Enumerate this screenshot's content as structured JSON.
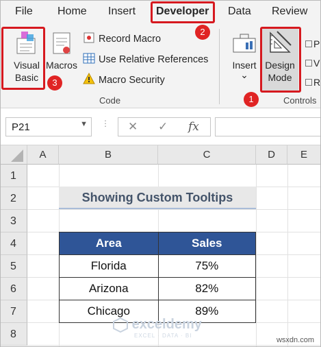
{
  "ribbon_tabs": [
    "File",
    "Home",
    "Insert",
    "Developer",
    "Data",
    "Review"
  ],
  "code_group": {
    "visual_basic": [
      "Visual",
      "Basic"
    ],
    "macros": "Macros",
    "record_macro": "Record Macro",
    "use_relative": "Use Relative References",
    "macro_security": "Macro Security",
    "label": "Code"
  },
  "controls_group": {
    "insert": "Insert",
    "insert_caret": "⌄",
    "design_mode": [
      "Design",
      "Mode"
    ],
    "label": "Controls",
    "cut_letters": [
      "P",
      "V",
      "R"
    ]
  },
  "callouts": [
    "1",
    "2",
    "3"
  ],
  "formula_bar": {
    "name_box": "P21",
    "cancel": "✕",
    "enter": "✓",
    "fx": "fx",
    "formula": ""
  },
  "columns": [
    "A",
    "B",
    "C",
    "D",
    "E"
  ],
  "rows": [
    "1",
    "2",
    "3",
    "4",
    "5",
    "6",
    "7",
    "8"
  ],
  "sheet": {
    "title": "Showing Custom Tooltips",
    "headers": [
      "Area",
      "Sales"
    ],
    "rows": [
      [
        "Florida",
        "75%"
      ],
      [
        "Arizona",
        "82%"
      ],
      [
        "Chicago",
        "89%"
      ]
    ]
  },
  "watermark": {
    "name": "exceldemy",
    "tagline": "EXCEL · DATA · BI"
  },
  "footer": "wsxdn.com",
  "colors": {
    "header_fill": "#2f5597",
    "title_fill": "#e8e8e8",
    "callout_red": "#d6191f"
  }
}
